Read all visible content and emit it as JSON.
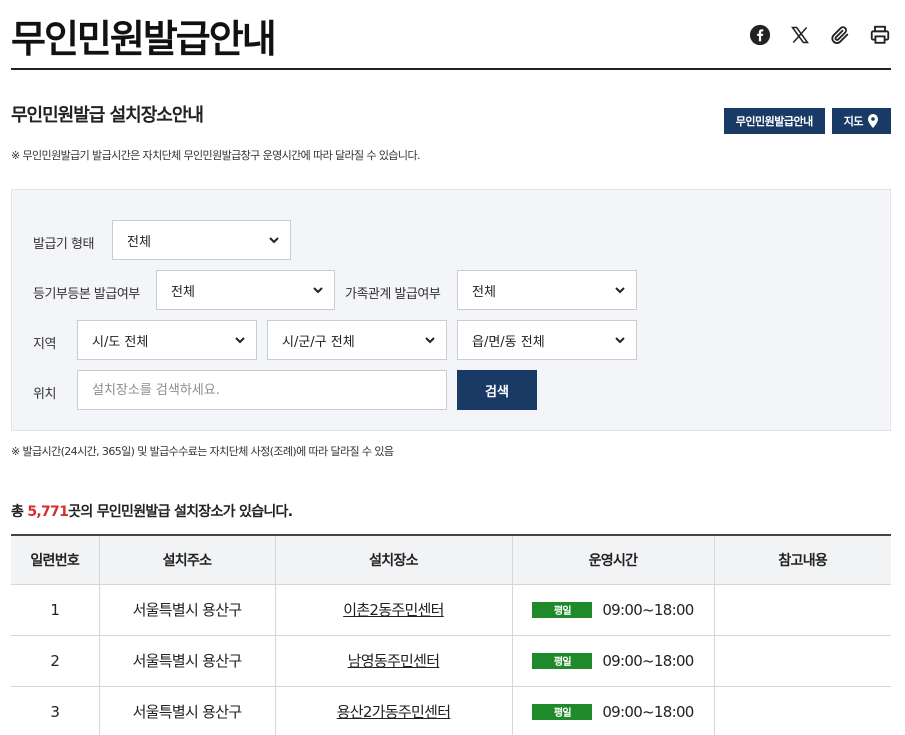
{
  "page": {
    "title": "무인민원발급안내",
    "icons": {
      "facebook": "facebook-icon",
      "x": "x-icon",
      "link": "paperclip-icon",
      "print": "print-icon"
    }
  },
  "section": {
    "title": "무인민원발급 설치장소안내",
    "guide_button": "무인민원발급안내",
    "map_button": "지도",
    "note_top": "※ 무인민원발급기 발급시간은 자치단체 무인민원발급창구 운영시간에 따라 달라질 수 있습니다.",
    "note_bottom": "※ 발급시간(24시간, 365일) 및 발급수수료는 자치단체 사정(조례)에 따라 달라질 수 있음"
  },
  "filters": {
    "type_label": "발급기 형태",
    "type_value": "전체",
    "registry_label": "등기부등본 발급여부",
    "registry_value": "전체",
    "family_label": "가족관계 발급여부",
    "family_value": "전체",
    "region_label": "지역",
    "sido_value": "시/도 전체",
    "sigungu_value": "시/군/구 전체",
    "eupmyeondong_value": "읍/면/동 전체",
    "location_label": "위치",
    "location_placeholder": "설치장소를 검색하세요.",
    "search_button": "검색"
  },
  "summary": {
    "prefix": "총 ",
    "count": "5,771",
    "suffix": "곳의 무인민원발급 설치장소가 있습니다."
  },
  "table": {
    "headers": [
      "일련번호",
      "설치주소",
      "설치장소",
      "운영시간",
      "참고내용"
    ],
    "rows": [
      {
        "no": "1",
        "address": "서울특별시 용산구",
        "place": "이촌2동주민센터",
        "badge": "평일",
        "hours": "09:00~18:00",
        "note": ""
      },
      {
        "no": "2",
        "address": "서울특별시 용산구",
        "place": "남영동주민센터",
        "badge": "평일",
        "hours": "09:00~18:00",
        "note": ""
      },
      {
        "no": "3",
        "address": "서울특별시 용산구",
        "place": "용산2가동주민센터",
        "badge": "평일",
        "hours": "09:00~18:00",
        "note": ""
      }
    ]
  },
  "colors": {
    "navy": "#1a3a66",
    "badge_green": "#1e8a2a",
    "count_red": "#d0312d"
  }
}
